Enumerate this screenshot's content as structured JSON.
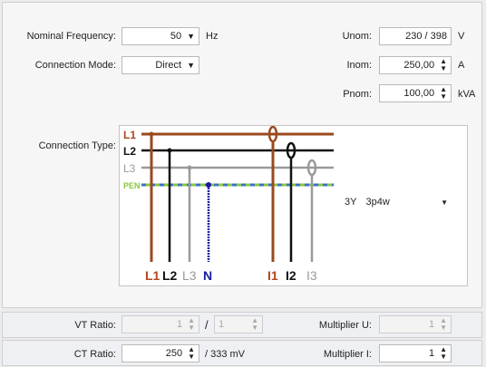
{
  "settings": {
    "frequency_label": "Nominal Frequency:",
    "frequency_value": "50",
    "frequency_unit": "Hz",
    "mode_label": "Connection Mode:",
    "mode_value": "Direct",
    "unom_label": "Unom:",
    "unom_value": "230 / 398",
    "unom_unit": "V",
    "inom_label": "Inom:",
    "inom_value": "250,00",
    "inom_unit": "A",
    "pnom_label": "Pnom:",
    "pnom_value": "100,00",
    "pnom_unit": "kVA",
    "type_label": "Connection Type:",
    "type_value_1": "3Y",
    "type_value_2": "3p4w"
  },
  "diagram": {
    "lines": [
      "L1",
      "L2",
      "L3",
      "PEN"
    ],
    "bottom_labels": [
      "L1",
      "L2",
      "L3",
      "N",
      "I1",
      "I2",
      "I3"
    ],
    "colors": {
      "l1": "#9a4a1e",
      "l2": "#111111",
      "l3": "#9a9a9a",
      "pen_green": "#8bc63e",
      "pen_blue": "#3a70c8",
      "n": "#1a1aa0",
      "l1_label": "#b1471c",
      "n_label": "#1a1aa0"
    }
  },
  "ratios": {
    "vt_label": "VT Ratio:",
    "vt_primary": "1",
    "vt_separator": "/",
    "vt_secondary": "1",
    "mult_u_label": "Multiplier U:",
    "mult_u_value": "1",
    "ct_label": "CT Ratio:",
    "ct_value": "250",
    "ct_suffix": "/ 333 mV",
    "mult_i_label": "Multiplier I:",
    "mult_i_value": "1"
  },
  "icons": {
    "dropdown": "▼",
    "spin_up": "▲",
    "spin_down": "▼"
  }
}
